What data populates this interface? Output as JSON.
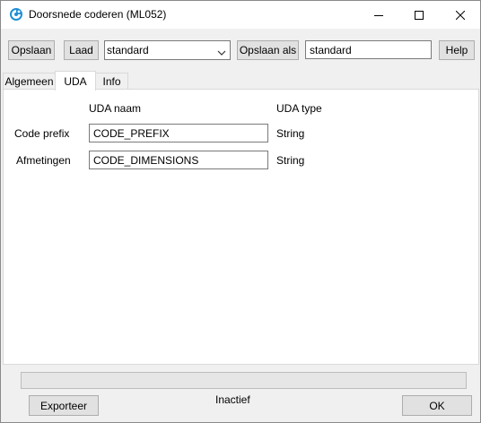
{
  "window": {
    "title": "Doorsnede coderen (ML052)",
    "controls": {
      "minimize": "minimize-icon",
      "maximize": "maximize-icon",
      "close": "close-icon"
    }
  },
  "toolbar": {
    "save_label": "Opslaan",
    "load_label": "Laad",
    "preset_value": "standard",
    "save_as_label": "Opslaan als",
    "save_as_value": "standard",
    "help_label": "Help"
  },
  "tabs": [
    {
      "label": "Algemeen",
      "active": false
    },
    {
      "label": "UDA",
      "active": true
    },
    {
      "label": "Info",
      "active": false
    }
  ],
  "uda": {
    "col_name": "UDA naam",
    "col_type": "UDA type",
    "rows": [
      {
        "label": "Code prefix",
        "name": "CODE_PREFIX",
        "type": "String"
      },
      {
        "label": "Afmetingen",
        "name": "CODE_DIMENSIONS",
        "type": "String"
      }
    ]
  },
  "footer": {
    "export_label": "Exporteer",
    "status_text": "Inactief",
    "ok_label": "OK",
    "progress": 0
  }
}
